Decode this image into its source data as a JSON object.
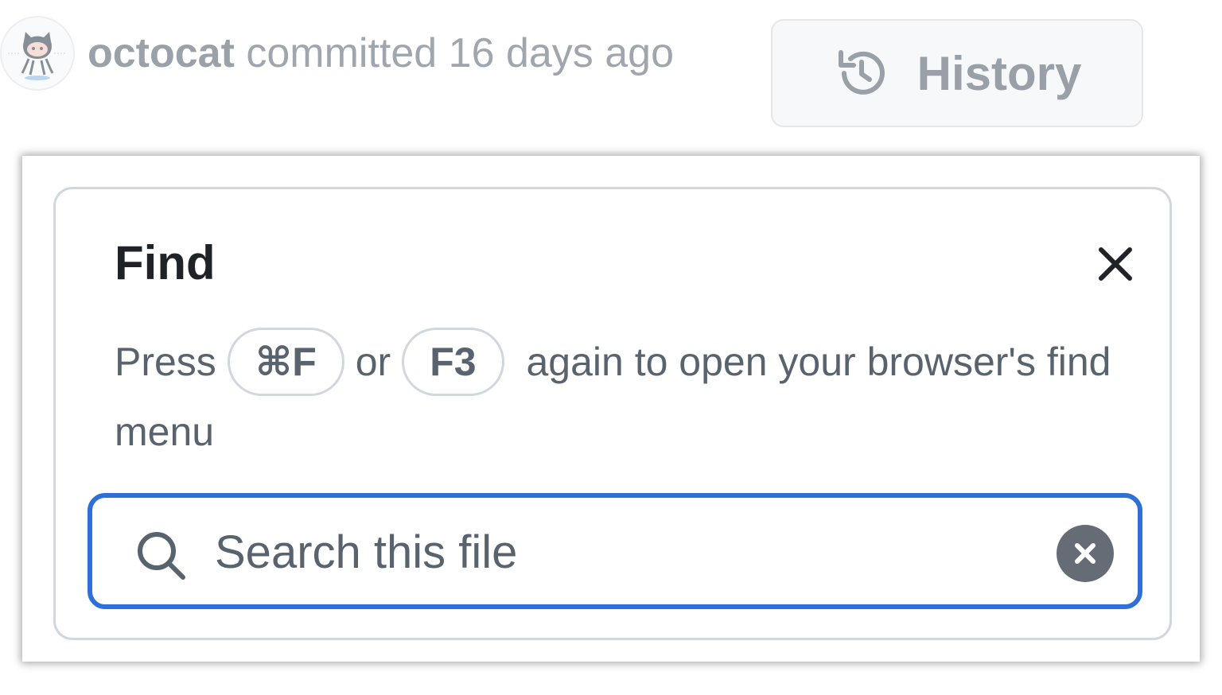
{
  "commit": {
    "author": "octocat",
    "action": "committed",
    "time": "16 days ago",
    "avatar_icon": "octocat-avatar-icon"
  },
  "history_button": {
    "label": "History",
    "icon": "history-icon"
  },
  "find_panel": {
    "title": "Find",
    "close_icon": "close-icon",
    "hint": {
      "prefix": "Press",
      "key1": "⌘F",
      "connector": "or",
      "key2": "F3",
      "suffix": "again to open your browser's find menu"
    },
    "search": {
      "placeholder": "Search this file",
      "value": "",
      "search_icon": "search-icon",
      "clear_icon": "clear-circle-icon"
    }
  },
  "colors": {
    "focus_border": "#2f6fd8",
    "muted_text": "#59636e",
    "title_text": "#1f2328",
    "clear_button": "#656c76"
  }
}
